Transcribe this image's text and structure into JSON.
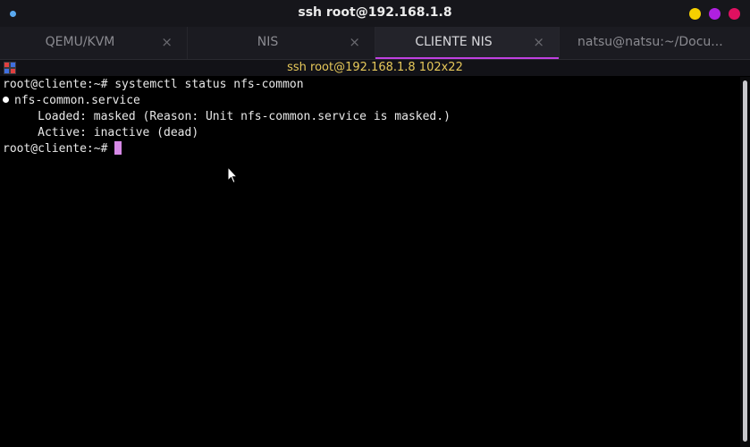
{
  "window": {
    "title": "ssh root@192.168.1.8",
    "indicator_color": "#5aa9f0",
    "buttons": [
      {
        "name": "minimize",
        "color": "#f5d000"
      },
      {
        "name": "maximize",
        "color": "#b020e0"
      },
      {
        "name": "close",
        "color": "#e01060"
      }
    ]
  },
  "tabs": [
    {
      "label": "QEMU/KVM",
      "close": "×",
      "active": false
    },
    {
      "label": "NIS",
      "close": "×",
      "active": false
    },
    {
      "label": "CLIENTE NIS",
      "close": "×",
      "active": true
    },
    {
      "label": "natsu@natsu:~/Docu...",
      "close": "",
      "active": false
    }
  ],
  "terminal": {
    "title": "ssh root@192.168.1.8 102x22",
    "title_color": "#e6c85a",
    "cursor_color": "#d689e6",
    "lines": {
      "prompt1": "root@cliente:~# systemctl status nfs-common",
      "service": "nfs-common.service",
      "loaded": "     Loaded: masked (Reason: Unit nfs-common.service is masked.)",
      "active": "     Active: inactive (dead)",
      "prompt2": "root@cliente:~#"
    }
  },
  "icons": {
    "terminal_app": "terminal-app-icon",
    "mouse": "mouse-pointer-icon"
  }
}
